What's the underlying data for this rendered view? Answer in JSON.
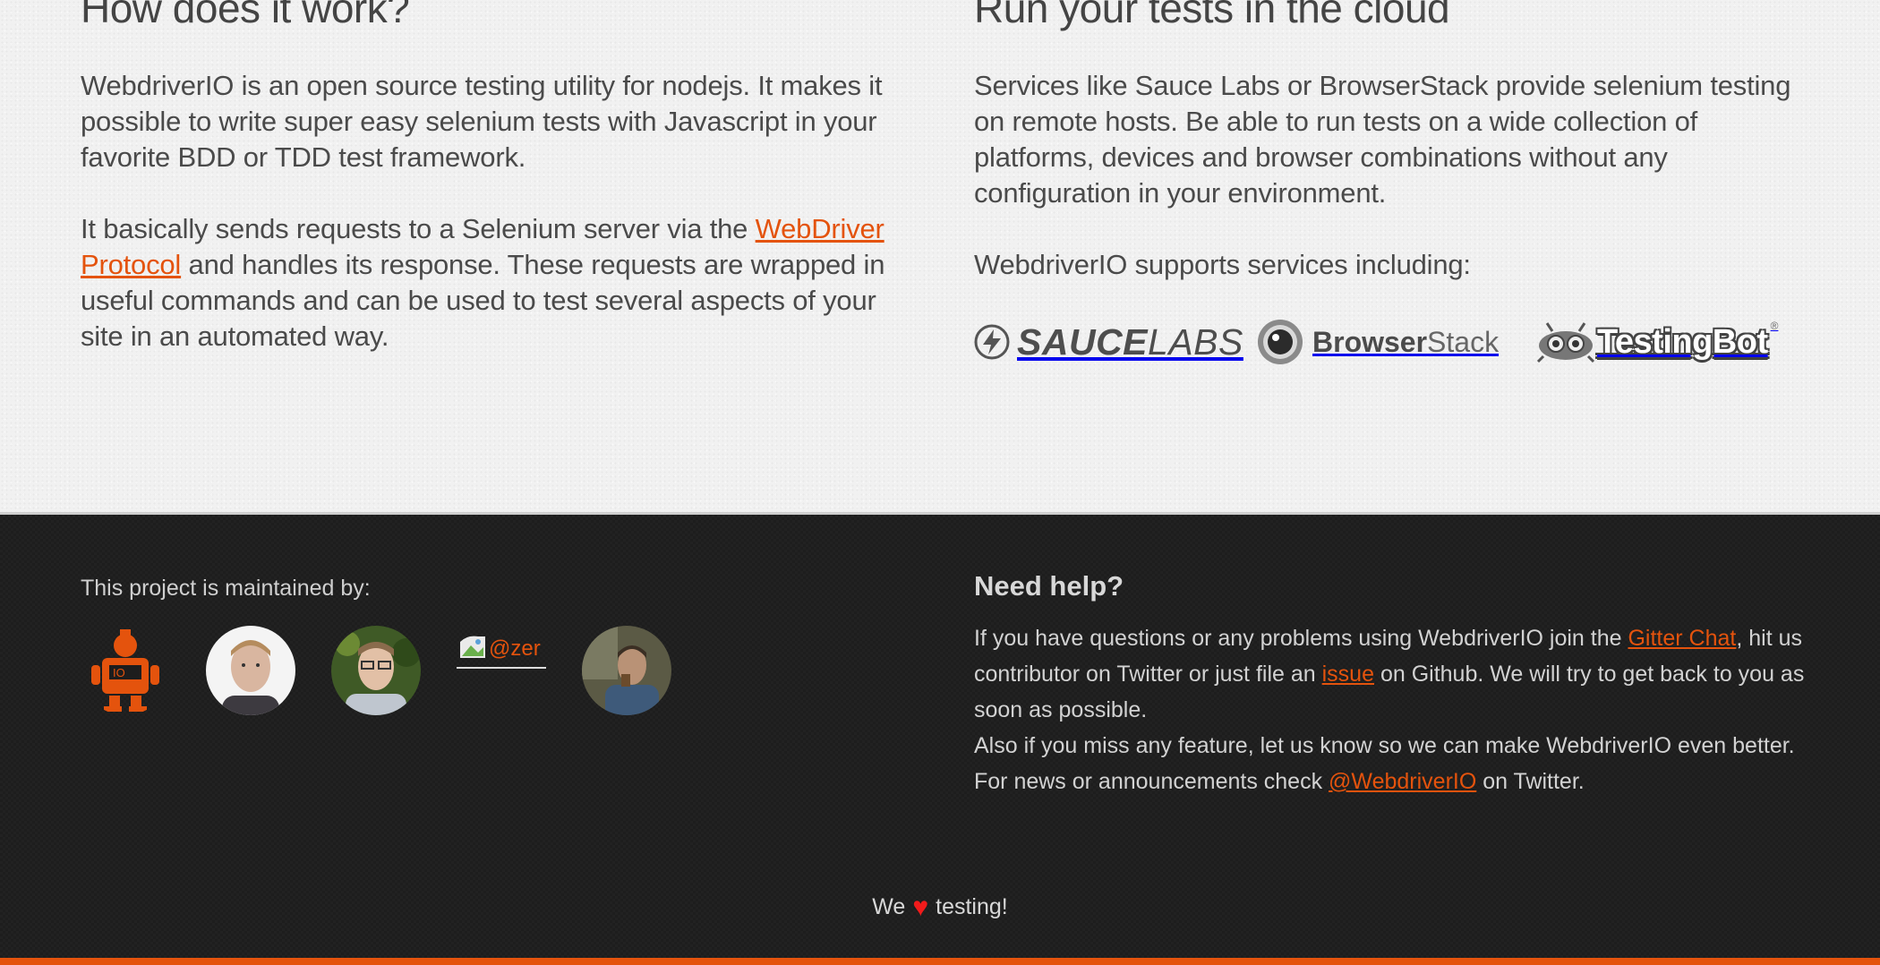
{
  "left": {
    "title": "How does it work?",
    "p1": "WebdriverIO is an open source testing utility for nodejs. It makes it possible to write super easy selenium tests with Javascript in your favorite BDD or TDD test framework.",
    "p2_before": "It basically sends requests to a Selenium server via the ",
    "p2_link": "WebDriver Protocol",
    "p2_after": " and handles its response. These requests are wrapped in useful commands and can be used to test several aspects of your site in an automated way."
  },
  "right": {
    "title": "Run your tests in the cloud",
    "p1": "Services like Sauce Labs or BrowserStack provide selenium testing on remote hosts. Be able to run tests on a wide collection of platforms, devices and browser combinations without any configuration in your environment.",
    "p2": "WebdriverIO supports services including:",
    "logos": {
      "saucelabs_bold": "SAUCE",
      "saucelabs_light": "LABS",
      "browserstack_bold": "Browser",
      "browserstack_light": "Stack",
      "testingbot": "TestingBot",
      "testingbot_reg": "®"
    }
  },
  "footer": {
    "maintained_label": "This project is maintained by:",
    "broken_avatar_alt": "@zer",
    "need_help_title": "Need help?",
    "help_1": "If you have questions or any problems using WebdriverIO join the ",
    "help_link_gitter": "Gitter Chat",
    "help_2": ", hit us contributor on Twitter or just file an ",
    "help_link_issue": "issue",
    "help_3": " on Github. We will try to get back to you as soon as possible.",
    "help_4": "Also if you miss any feature, let us know so we can make WebdriverIO even better.",
    "help_5": "For news or announcements check ",
    "help_link_twitter": "@WebdriverIO",
    "help_6": " on Twitter.",
    "love_before": "We",
    "love_heart": "♥",
    "love_after": "testing!"
  },
  "colors": {
    "accent": "#e4530d",
    "footer_bg": "#1d1d1d",
    "heart": "#f21b1b"
  }
}
